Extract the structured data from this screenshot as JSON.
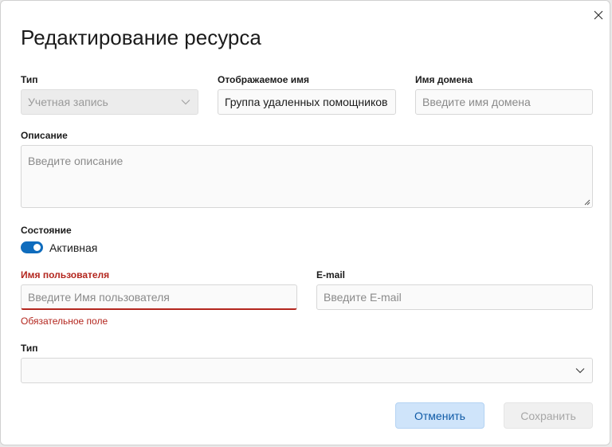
{
  "dialog": {
    "title": "Редактирование ресурса",
    "close_icon": "close-icon"
  },
  "form": {
    "type_label": "Тип",
    "type_value": "Учетная запись",
    "display_name_label": "Отображаемое имя",
    "display_name_value": "Группа удаленных помощников",
    "domain_label": "Имя домена",
    "domain_placeholder": "Введите имя домена",
    "description_label": "Описание",
    "description_placeholder": "Введите описание",
    "state_label": "Состояние",
    "state_toggle_label": "Активная",
    "state_on": true,
    "username_label": "Имя пользователя",
    "username_placeholder": "Введите Имя пользователя",
    "username_error": "Обязательное поле",
    "email_label": "E-mail",
    "email_placeholder": "Введите E-mail",
    "type2_label": "Тип",
    "type2_value": ""
  },
  "actions": {
    "cancel_label": "Отменить",
    "save_label": "Сохранить"
  },
  "colors": {
    "accent": "#0f6cbd",
    "error": "#b3261e",
    "cancel_bg": "#cfe4fa",
    "disabled_text": "#a7a7a7"
  }
}
